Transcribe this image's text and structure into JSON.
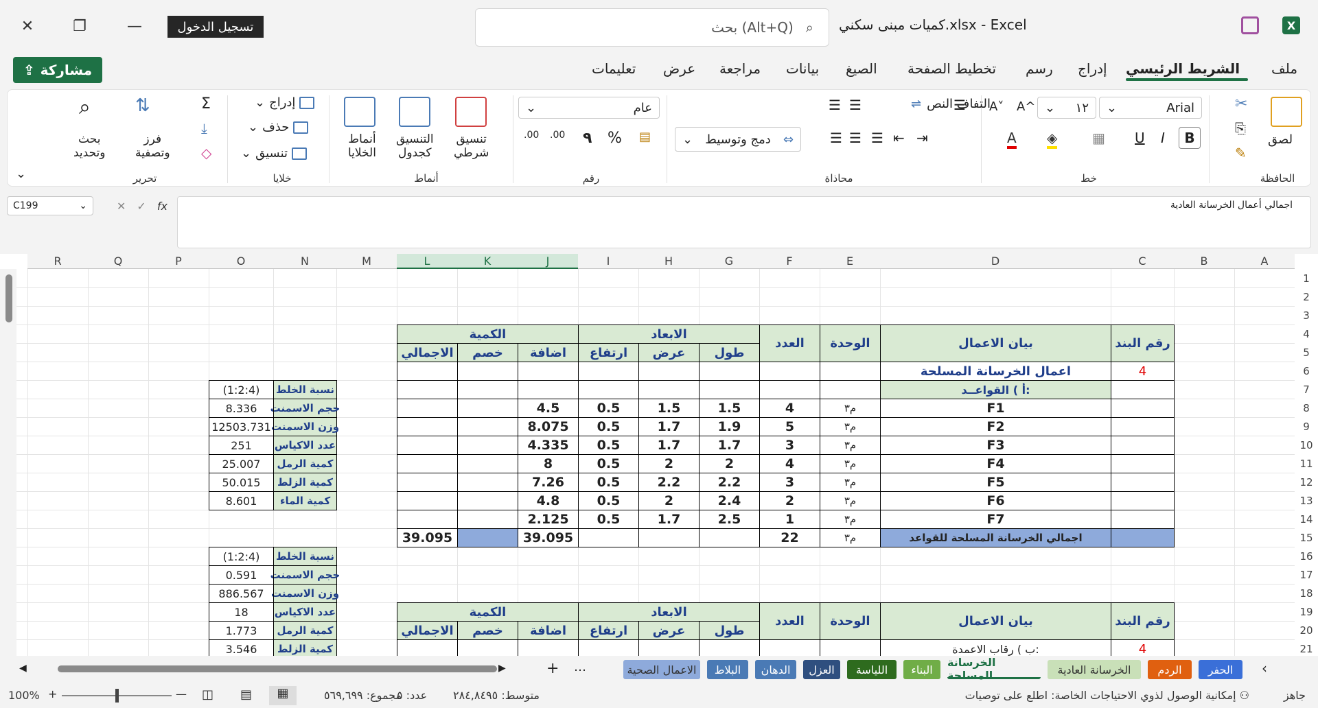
{
  "window": {
    "signin": "تسجيل الدخول",
    "search_placeholder": "بحث (Alt+Q)",
    "doc_title": "كميات مبنى سكني.xlsx  -  Excel"
  },
  "tabs": {
    "share": "مشاركة",
    "items": [
      "ملف",
      "الشريط الرئيسي",
      "إدراج",
      "رسم",
      "تخطيط الصفحة",
      "الصيغ",
      "بيانات",
      "مراجعة",
      "عرض",
      "تعليمات"
    ]
  },
  "ribbon": {
    "clipboard": {
      "label": "الحافظة",
      "paste": "لصق"
    },
    "font": {
      "label": "خط",
      "name": "Arial",
      "size": "١٢",
      "bold": "B",
      "italic": "I",
      "underline": "U",
      "grow": "A^",
      "shrink": "A˅"
    },
    "alignment": {
      "label": "محاذاة",
      "wrap": "التفاف النص",
      "merge": "دمج وتوسيط"
    },
    "number": {
      "label": "رقم",
      "format": "عام",
      "percent": "%",
      "comma": "٩",
      "inc": ".00",
      "dec": ".00"
    },
    "styles": {
      "label": "أنماط",
      "cond1": "تنسيق",
      "cond2": "شرطي",
      "table1": "التنسيق",
      "table2": "كجدول",
      "cell1": "أنماط",
      "cell2": "الخلايا"
    },
    "cells": {
      "label": "خلايا",
      "insert": "إدراج",
      "delete": "حذف",
      "format": "تنسيق"
    },
    "editing": {
      "label": "تحرير",
      "sort1": "فرز",
      "sort2": "وتصفية",
      "find1": "بحث",
      "find2": "وتحديد"
    }
  },
  "formula": {
    "namebox": "C199",
    "fx": "fx",
    "content": "اجمالي أعمال الخرسانة العادية"
  },
  "columns": [
    "A",
    "B",
    "C",
    "D",
    "E",
    "F",
    "G",
    "H",
    "I",
    "J",
    "K",
    "L",
    "M",
    "N",
    "O",
    "P",
    "Q",
    "R"
  ],
  "rows": [
    "1",
    "2",
    "3",
    "4",
    "5",
    "6",
    "7",
    "8",
    "9",
    "10",
    "11",
    "12",
    "13",
    "14",
    "15",
    "16",
    "17",
    "18",
    "19",
    "20",
    "21"
  ],
  "table": {
    "h_item": "رقم البند",
    "h_desc": "بيان الاعمال",
    "h_unit": "الوحدة",
    "h_count": "العدد",
    "h_dims": "الابعاد",
    "h_qty": "الكمية",
    "h_len": "طول",
    "h_wid": "عرض",
    "h_hgt": "ارتفاع",
    "h_add": "اضافة",
    "h_sub": "خصم",
    "h_total": "الاجمالي",
    "item_no": "4",
    "section": "اعمال الخرسانة المسلحة",
    "subsection": "أ ) القواعــد:",
    "rows": [
      {
        "d": "F1",
        "u": "م٣",
        "n": "4",
        "l": "1.5",
        "w": "1.5",
        "h": "0.5",
        "a": "4.5"
      },
      {
        "d": "F2",
        "u": "م٣",
        "n": "5",
        "l": "1.9",
        "w": "1.7",
        "h": "0.5",
        "a": "8.075"
      },
      {
        "d": "F3",
        "u": "م٣",
        "n": "3",
        "l": "1.7",
        "w": "1.7",
        "h": "0.5",
        "a": "4.335"
      },
      {
        "d": "F4",
        "u": "م٣",
        "n": "4",
        "l": "2",
        "w": "2",
        "h": "0.5",
        "a": "8"
      },
      {
        "d": "F5",
        "u": "م٣",
        "n": "3",
        "l": "2.2",
        "w": "2.2",
        "h": "0.5",
        "a": "7.26"
      },
      {
        "d": "F6",
        "u": "م٣",
        "n": "2",
        "l": "2.4",
        "w": "2",
        "h": "0.5",
        "a": "4.8"
      },
      {
        "d": "F7",
        "u": "م٣",
        "n": "1",
        "l": "2.5",
        "w": "1.7",
        "h": "0.5",
        "a": "2.125"
      }
    ],
    "total_label": "اجمالي الخرسانة المسلحة للقواعد",
    "total_unit": "م٣",
    "total_count": "22",
    "total_add": "39.095",
    "total_total": "39.095",
    "item2": "4",
    "item2_desc": "ب ) رقاب الاعمدة:"
  },
  "side1": [
    [
      "نسبة الخلط",
      "(1:2:4)"
    ],
    [
      "حجم الاسمنت",
      "8.336"
    ],
    [
      "وزن الاسمنت",
      "12503.731"
    ],
    [
      "عدد الاكياس",
      "251"
    ],
    [
      "كمية الرمل",
      "25.007"
    ],
    [
      "كمية الزلط",
      "50.015"
    ],
    [
      "كمية الماء",
      "8.601"
    ]
  ],
  "side2": [
    [
      "نسبة الخلط",
      "(1:2:4)"
    ],
    [
      "حجم الاسمنت",
      "0.591"
    ],
    [
      "وزن الاسمنت",
      "886.567"
    ],
    [
      "عدد الاكياس",
      "18"
    ],
    [
      "كمية الرمل",
      "1.773"
    ],
    [
      "كمية الزلط",
      "3.546"
    ]
  ],
  "sheets": [
    "الحفر",
    "الردم",
    "الخرسانة العادية",
    "الخرسانة المسلحة",
    "البناء",
    "اللياسة",
    "العزل",
    "الدهان",
    "البلاط",
    "الاعمال الصحية"
  ],
  "status": {
    "ready": "جاهز",
    "access": "إمكانية الوصول لذوي الاحتياجات الخاصة: اطلع على توصيات",
    "avg": "متوسط: ٢٨٤,٨٤٩٥",
    "count": "عدد: ٥",
    "sum": "مجموع: ٥٦٩,٦٩٩",
    "zoom": "100%"
  },
  "colors": {
    "excel_green": "#1e7145",
    "header_green": "#d9ead3",
    "total_blue": "#8eaadb"
  }
}
